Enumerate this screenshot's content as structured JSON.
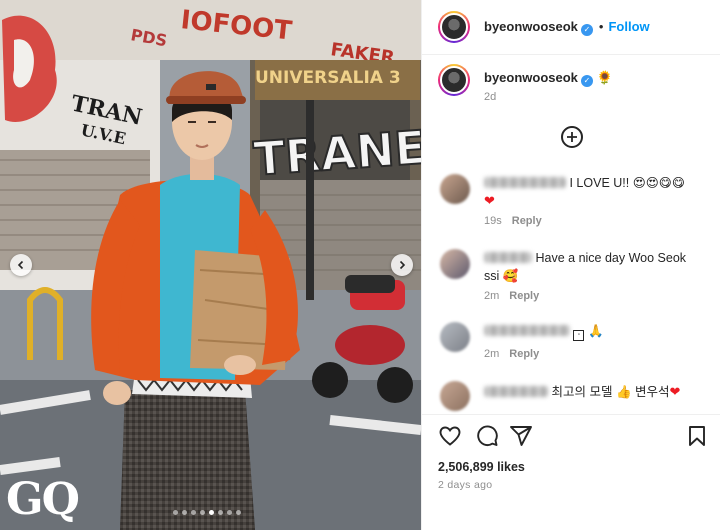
{
  "header": {
    "username": "byeonwooseok",
    "separator": "•",
    "follow_label": "Follow"
  },
  "caption": {
    "username": "byeonwooseok",
    "emoji": "🌻",
    "time": "2d"
  },
  "comments": [
    {
      "text": "I LOVE U!!",
      "emoji": [
        "😍",
        "😍",
        "😋",
        "😋"
      ],
      "heart": "❤",
      "time": "19s",
      "reply": "Reply"
    },
    {
      "text": "Have a nice day Woo Seok ssi",
      "emoji": [
        "🥰"
      ],
      "time": "2m",
      "reply": "Reply"
    },
    {
      "text": "",
      "emoji": [
        "🙏"
      ],
      "time": "2m",
      "reply": "Reply"
    },
    {
      "text": "최고의 모델",
      "emoji_mid": "👍",
      "text2": "변우석",
      "heart": "❤"
    }
  ],
  "likes": "2,506,899 likes",
  "posted": "2 days ago",
  "media": {
    "logo": "GQ",
    "carousel_count": 8,
    "carousel_active": 4,
    "graffiti": [
      "IOFOOT",
      "FAKER",
      "TRANE",
      "UNIVERSALIA 3",
      "PDS"
    ]
  },
  "icons": {
    "verified": "verified-badge-icon",
    "plus": "plus-circle-icon",
    "like": "heart-outline-icon",
    "comment": "comment-bubble-icon",
    "share": "paper-plane-icon",
    "save": "bookmark-icon",
    "prev": "chevron-left-icon",
    "next": "chevron-right-icon"
  },
  "colors": {
    "link": "#0095f6",
    "verified": "#3897f0",
    "muted": "#8e8e8e",
    "heart": "#ed1c24"
  }
}
